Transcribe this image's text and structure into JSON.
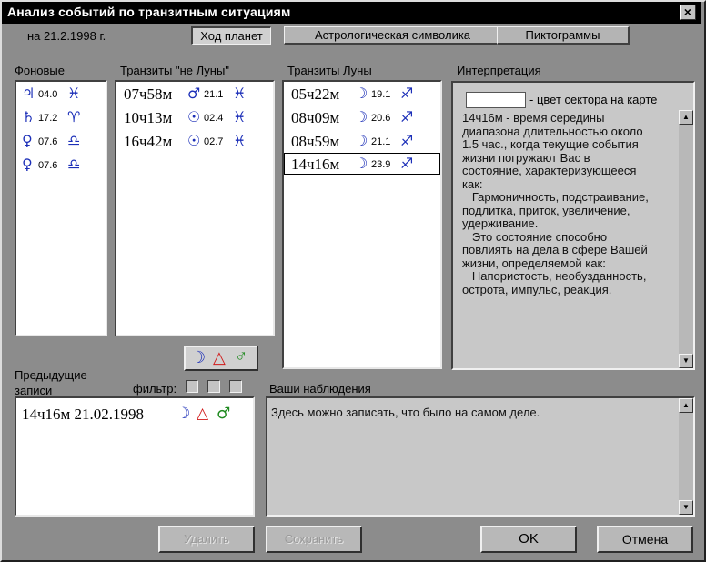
{
  "window": {
    "title": "Анализ событий по транзитным ситуациям",
    "close_glyph": "×"
  },
  "date_label": "на 21.2.1998 г.",
  "tabs": [
    "Ход планет",
    "Астрологическая символика",
    "Пиктограммы"
  ],
  "columns": {
    "background": "Фоновые",
    "non_moon": "Транзиты \"не Луны\"",
    "moon": "Транзиты Луны",
    "interpretation": "Интерпретация"
  },
  "background_items": [
    {
      "planet": "♃",
      "deg": "04.0",
      "sign": "♓"
    },
    {
      "planet": "♄",
      "deg": "17.2",
      "sign": "♈"
    },
    {
      "planet": "♀",
      "deg": "07.6",
      "sign": "♎"
    },
    {
      "planet": "♀",
      "deg": "07.6",
      "sign": "♎"
    }
  ],
  "non_moon_items": [
    {
      "time": "07ч58м",
      "planet": "♂",
      "deg": "21.1",
      "sign": "♓"
    },
    {
      "time": "10ч13м",
      "planet": "☉",
      "deg": "02.4",
      "sign": "♓"
    },
    {
      "time": "16ч42м",
      "planet": "☉",
      "deg": "02.7",
      "sign": "♓"
    }
  ],
  "moon_items": [
    {
      "time": "05ч22м",
      "planet": "☽",
      "deg": "19.1",
      "sign": "♐"
    },
    {
      "time": "08ч09м",
      "planet": "☽",
      "deg": "20.6",
      "sign": "♐"
    },
    {
      "time": "08ч59м",
      "planet": "☽",
      "deg": "21.1",
      "sign": "♐"
    },
    {
      "time": "14ч16м",
      "planet": "☽",
      "deg": "23.9",
      "sign": "♐"
    }
  ],
  "interpretation": {
    "sector_label": "- цвет сектора на карте",
    "text": "14ч16м - время середины\nдиапазона длительностью около\n1.5 час., когда текущие события\nжизни погружают Вас в\nсостояние, характеризующееся\nкак:\n   Гармоничность, подстраивание,\nподлитка, приток, увеличение,\nудерживание.\n   Это состояние способно\nповлиять на дела в сфере Вашей\nжизни, определяемой как:\n   Напористость, необузданность,\nострота, импульс, реакция."
  },
  "previous": {
    "label": "Предыдущие записи",
    "filter_label": "фильтр:",
    "filter_icons": [
      "☽",
      "△",
      "♂"
    ],
    "entries": [
      {
        "text": "14ч16м 21.02.1998",
        "icons": [
          "☽",
          "△",
          "♂"
        ]
      }
    ]
  },
  "notes": {
    "label": "Ваши наблюдения",
    "value": "Здесь можно записать, что было на самом деле."
  },
  "buttons": {
    "delete": "Удалить",
    "save": "Сохранить",
    "ok": "OK",
    "cancel": "Отмена"
  },
  "colors": {
    "glyph_blue": "#1c2fb8",
    "triangle_red": "#d01818",
    "mars_green": "#1f8a1f"
  }
}
